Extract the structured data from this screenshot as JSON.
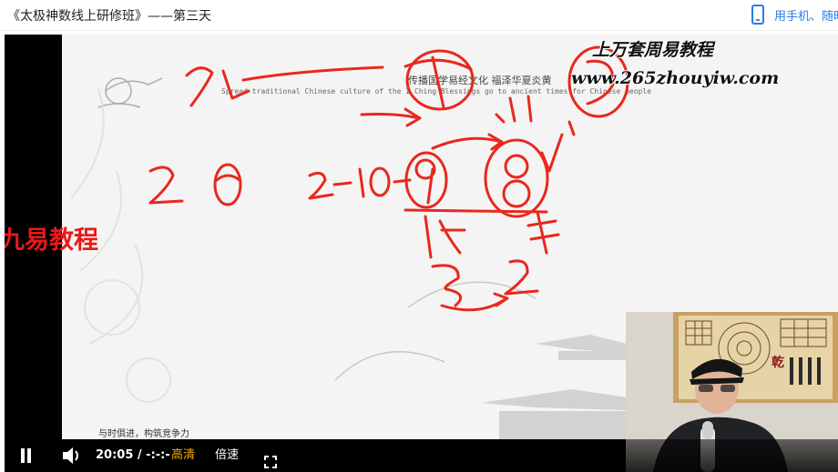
{
  "page": {
    "title": "《太极神数线上研修班》——第三天",
    "phone_link": "用手机、随时"
  },
  "slide": {
    "header_cn": "传播国学易经文化   福泽华夏炎黄",
    "header_en": "Spread traditional Chinese culture of the I Ching Blessings go to ancient times for Chinese people",
    "footer_cn": "与时俱进，构筑竞争力"
  },
  "watermarks": {
    "courses": "上万套周易教程",
    "url": "www.265zhouyiw.com",
    "brand": "九易教程"
  },
  "controls": {
    "time": "20:05  /  -:-:-",
    "quality": "高清",
    "speed": "倍速"
  },
  "icons": {
    "phone": "phone-icon",
    "pause": "pause-icon",
    "volume": "volume-icon",
    "fullscreen": "fullscreen-icon"
  },
  "colors": {
    "link": "#2a7be4",
    "ink": "#e8281e",
    "brand": "#e81919",
    "quality": "#f5b000"
  }
}
